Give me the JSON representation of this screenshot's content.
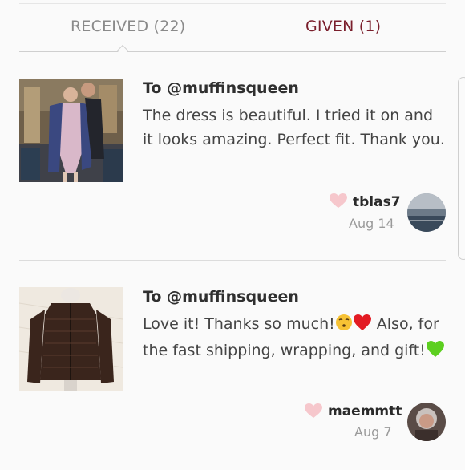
{
  "tabs": {
    "received": "RECEIVED (22)",
    "given": "GIVEN (1)",
    "received_color": "#8a8a8a",
    "given_color": "#7a1f2c"
  },
  "reviews": [
    {
      "to": "To @muffinsqueen",
      "message": "The dress is beautiful. I tried it on and it looks amazing. Perfect fit. Thank you.",
      "username": "tblas7",
      "date": "Aug 14",
      "item_image": "dress-photo",
      "avatar_image": "ocean-avatar"
    },
    {
      "to": "To @muffinsqueen",
      "message_part1": "Love it! Thanks so much!",
      "message_part2": " Also, for the fast shipping, wrapping, and gift!",
      "emoji_1": "kissing-face-emoji",
      "emoji_2": "red-heart-emoji",
      "emoji_3": "green-heart-emoji",
      "username": "maemmtt",
      "date": "Aug 7",
      "item_image": "jacket-photo",
      "avatar_image": "portrait-avatar"
    }
  ],
  "colors": {
    "heart": "#f6c7cc",
    "accent": "#7a1f2c"
  }
}
